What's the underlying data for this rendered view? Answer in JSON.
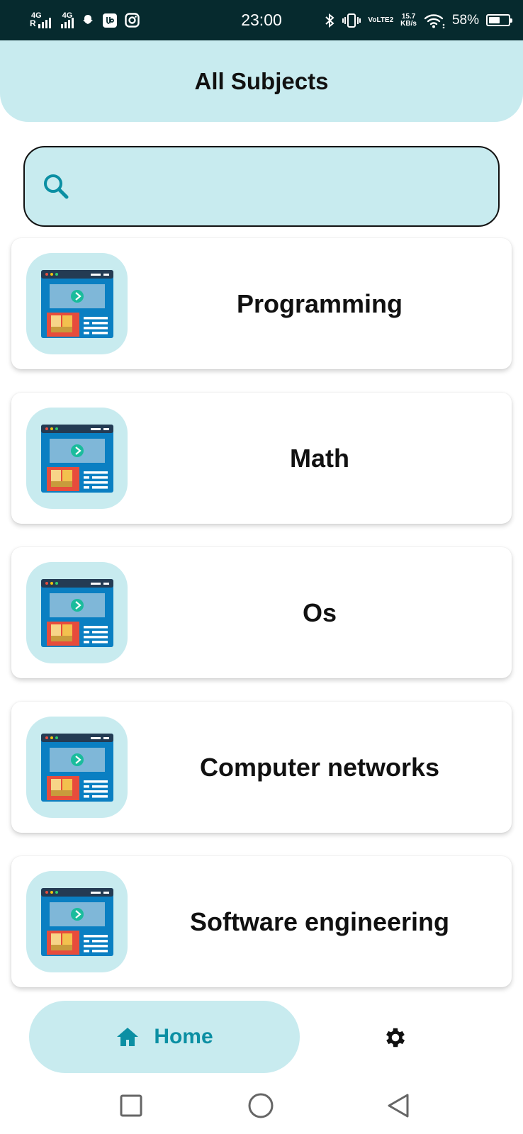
{
  "status_bar": {
    "time": "23:00",
    "battery_percent": "58%",
    "battery_level": 0.58,
    "network_speed": "15.7",
    "network_speed_unit": "KB/s",
    "volte_label": "VoLTE2",
    "sim1_tag": "4G",
    "sim1_roaming": "R",
    "sim2_tag": "4G",
    "icons": [
      "signal-icon",
      "signal-icon",
      "snapchat-icon",
      "app-icon",
      "instagram-icon",
      "bluetooth-icon",
      "vibrate-icon",
      "wifi-icon",
      "battery-icon"
    ]
  },
  "header": {
    "title": "All Subjects"
  },
  "search": {
    "placeholder": "",
    "value": "",
    "icon": "search-icon"
  },
  "subjects": [
    {
      "label": "Programming",
      "icon": "course-screen-icon"
    },
    {
      "label": "Math",
      "icon": "course-screen-icon"
    },
    {
      "label": "Os",
      "icon": "course-screen-icon"
    },
    {
      "label": "Computer networks",
      "icon": "course-screen-icon"
    },
    {
      "label": "Software engineering",
      "icon": "course-screen-icon"
    }
  ],
  "bottom_nav": {
    "home_label": "Home",
    "home_icon": "home-icon",
    "settings_icon": "gear-icon"
  },
  "system_nav": {
    "icons": [
      "recents-icon",
      "home-circle-icon",
      "back-icon"
    ]
  },
  "colors": {
    "status_bar_bg": "#062a2e",
    "accent_light": "#c8ebef",
    "accent": "#0b8fa3",
    "text": "#111111"
  }
}
